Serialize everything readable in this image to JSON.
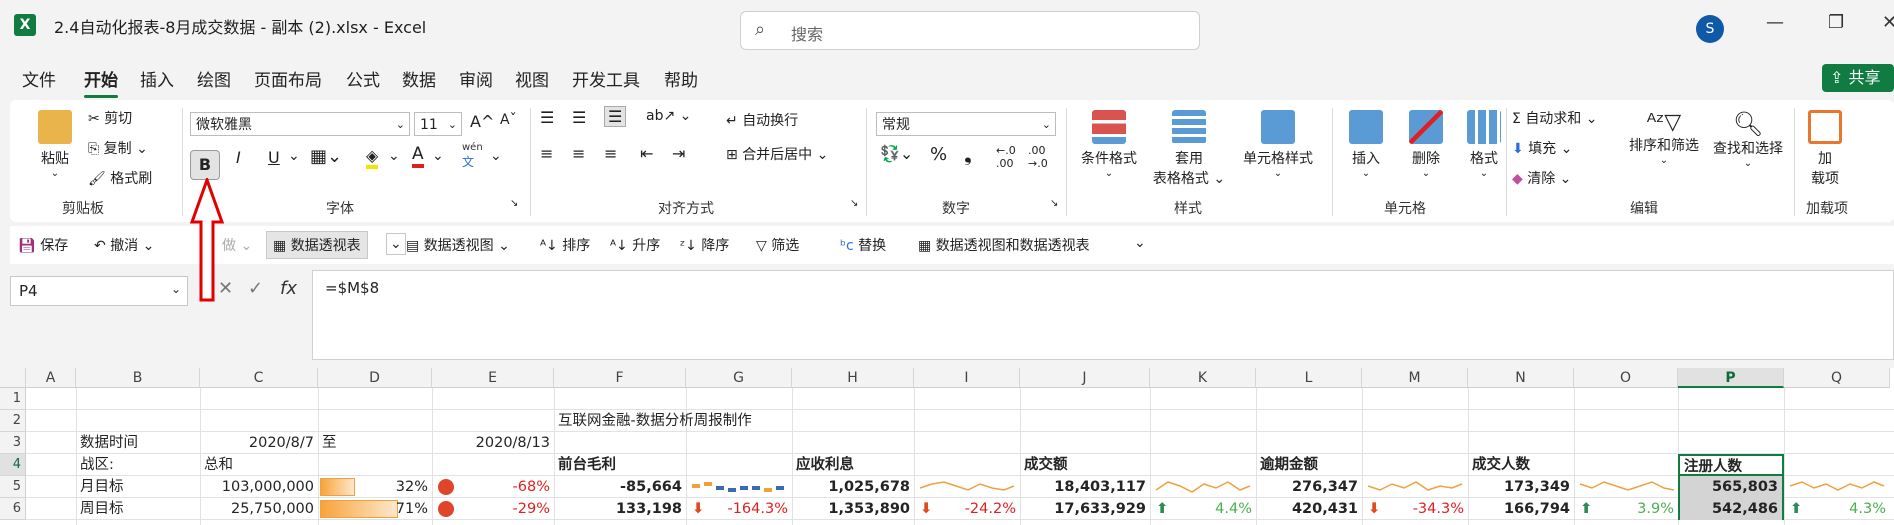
{
  "window": {
    "app_icon": "X",
    "title": "2.4自动化报表-8月成交数据 - 副本 (2).xlsx  -  Excel",
    "search_placeholder": "搜索",
    "avatar": "S"
  },
  "menu": {
    "tabs": [
      "文件",
      "开始",
      "插入",
      "绘图",
      "页面布局",
      "公式",
      "数据",
      "审阅",
      "视图",
      "开发工具",
      "帮助"
    ],
    "active": "开始",
    "share_label": "共享"
  },
  "ribbon": {
    "clipboard": {
      "paste": "粘贴",
      "cut": "剪切",
      "copy": "复制",
      "format_painter": "格式刷",
      "group": "剪贴板"
    },
    "font": {
      "name": "微软雅黑",
      "size": "11",
      "bold": "B",
      "italic": "I",
      "underline": "U",
      "phonetic": "wén",
      "group": "字体"
    },
    "alignment": {
      "wrap": "自动换行",
      "merge": "合并后居中",
      "group": "对齐方式"
    },
    "number": {
      "format": "常规",
      "group": "数字"
    },
    "styles": {
      "conditional": "条件格式",
      "table_line1": "套用",
      "table_line2": "表格格式",
      "cell_styles": "单元格样式",
      "group": "样式"
    },
    "cells": {
      "insert": "插入",
      "delete": "删除",
      "format": "格式",
      "group": "单元格"
    },
    "editing": {
      "autosum": "自动求和",
      "fill": "填充",
      "clear": "清除",
      "sort_filter": "排序和筛选",
      "find_select": "查找和选择",
      "group": "编辑"
    },
    "addins": {
      "label_line1": "加",
      "label_line2": "载项",
      "group": "加载项"
    }
  },
  "qat": {
    "save": "保存",
    "undo": "撤消",
    "redo": "做",
    "pivot_table": "数据透视表",
    "pivot_view": "数据透视图",
    "sort": "排序",
    "asc": "升序",
    "desc": "降序",
    "filter": "筛选",
    "replace": "替换",
    "pivot_both": "数据透视图和数据透视表"
  },
  "formula_bar": {
    "name_box": "P4",
    "formula": "=$M$8"
  },
  "grid": {
    "columns": [
      "A",
      "B",
      "C",
      "D",
      "E",
      "F",
      "G",
      "H",
      "I",
      "J",
      "K",
      "L",
      "M",
      "N",
      "O",
      "P",
      "Q"
    ],
    "selected_column": "P",
    "rows": [
      "1",
      "2",
      "3",
      "4",
      "5",
      "6"
    ],
    "title": "互联网金融-数据分析周报制作",
    "r3": {
      "label": "数据时间",
      "start": "2020/8/7",
      "to": "至",
      "end": "2020/8/13"
    },
    "r4": {
      "area": "战区:",
      "total": "总和",
      "f": "前台毛利",
      "h": "应收利息",
      "j": "成交额",
      "l": "逾期金额",
      "n": "成交人数",
      "p": "注册人数"
    },
    "r5": {
      "label": "月目标",
      "value": "103,000,000",
      "pct": "32%",
      "ratio": "-68%",
      "f": "-85,664",
      "h": "1,025,678",
      "j": "18,403,117",
      "l": "276,347",
      "n": "173,349",
      "p": "565,803",
      "bar_fraction": 0.32
    },
    "r6": {
      "label": "周目标",
      "value": "25,750,000",
      "pct": "71%",
      "ratio": "-29%",
      "f": "133,198",
      "g": "-164.3%",
      "h": "1,353,890",
      "i": "-24.2%",
      "j": "17,633,929",
      "k": "4.4%",
      "l": "420,431",
      "m": "-34.3%",
      "n": "166,794",
      "o": "3.9%",
      "p": "542,486",
      "q": "4.3%",
      "bar_fraction": 0.71
    }
  },
  "colors": {
    "accent": "#107c41",
    "red": "#e02020",
    "green": "#4caf50",
    "bar": "#f7a43a"
  }
}
